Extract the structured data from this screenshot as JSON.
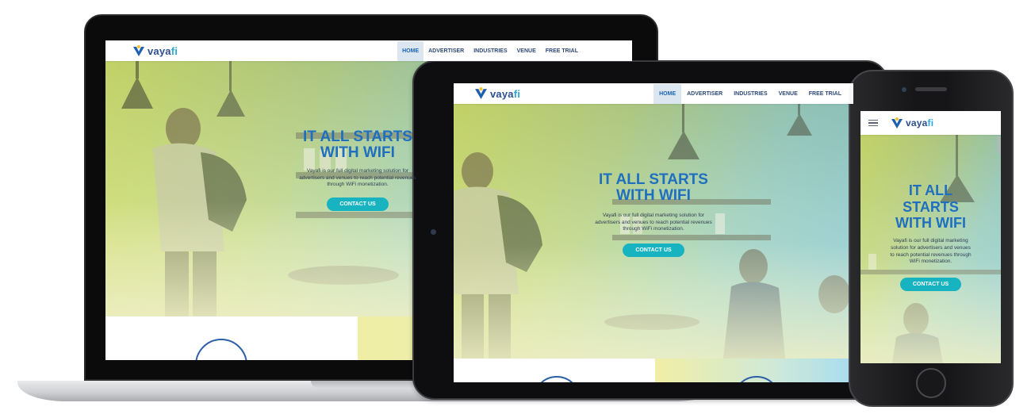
{
  "brand": {
    "name_prefix": "vaya",
    "name_suffix": "fi"
  },
  "nav": {
    "items": [
      {
        "label": "HOME",
        "active": true
      },
      {
        "label": "ADVERTISER",
        "active": false
      },
      {
        "label": "INDUSTRIES",
        "active": false
      },
      {
        "label": "VENUE",
        "active": false
      },
      {
        "label": "FREE TRIAL",
        "active": false
      }
    ]
  },
  "hero": {
    "title_line1": "IT ALL STARTS",
    "title_line2": "WITH WIFI",
    "phone_title_line1": "IT ALL",
    "phone_title_line2": "STARTS",
    "phone_title_line3": "WITH WIFI",
    "laptop_description": "Vayafi is our full digital marketing solution for advertisers and venues to reach potential revenues through WiFi monetization.",
    "description": "Vayafi is our full digital marketing solution for advertisers and venues to reach potential revenues through WiFi monetization.",
    "cta_label": "CONTACT US"
  },
  "colors": {
    "accent": "#17b3c0",
    "brand_blue": "#1f6fc0",
    "nav_text": "#2d4a78"
  },
  "icons": {
    "logo": "vayafi-logo-mark",
    "menu": "hamburger-icon"
  }
}
